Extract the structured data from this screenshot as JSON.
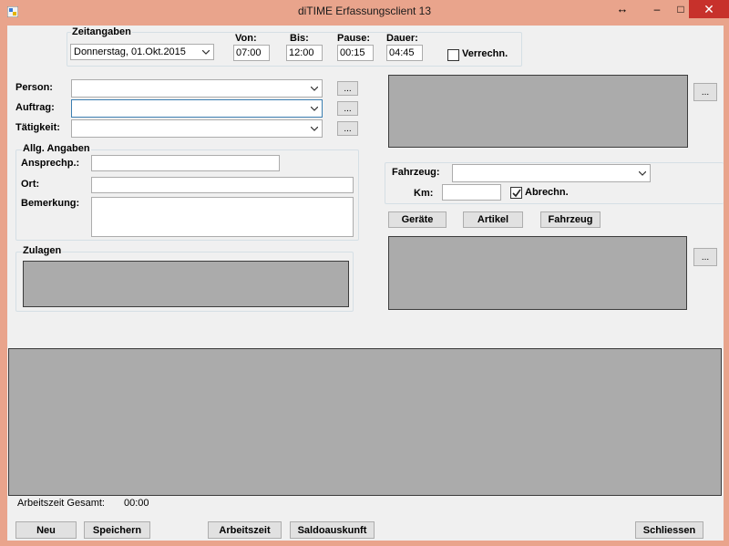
{
  "window": {
    "title": "diTIME Erfassungsclient 13",
    "controls": {
      "resize": "↔",
      "minimize": "–",
      "maximize": "□",
      "close": "✕"
    }
  },
  "zeitangaben": {
    "group_title": "Zeitangaben",
    "date_value": "Donnerstag, 01.Okt.2015",
    "von_label": "Von:",
    "von_value": "07:00",
    "bis_label": "Bis:",
    "bis_value": "12:00",
    "pause_label": "Pause:",
    "pause_value": "00:15",
    "dauer_label": "Dauer:",
    "dauer_value": "04:45",
    "verrechn_label": "Verrechn.",
    "verrechn_checked": false
  },
  "form": {
    "person_label": "Person:",
    "auftrag_label": "Auftrag:",
    "taetigkeit_label": "Tätigkeit:",
    "browse_label": "..."
  },
  "allg_angaben": {
    "group_title": "Allg. Angaben",
    "ansprechp_label": "Ansprechp.:",
    "ort_label": "Ort:",
    "bemerkung_label": "Bemerkung:"
  },
  "zulagen": {
    "group_title": "Zulagen"
  },
  "fahrzeug": {
    "fahrzeug_label": "Fahrzeug:",
    "km_label": "Km:",
    "abrechn_label": "Abrechn.",
    "abrechn_checked": true
  },
  "tabs": {
    "geraete": "Geräte",
    "artikel": "Artikel",
    "fahrzeug": "Fahrzeug"
  },
  "summary": {
    "arbeitszeit_label": "Arbeitszeit Gesamt:",
    "arbeitszeit_value": "00:00"
  },
  "footer": {
    "neu": "Neu",
    "speichern": "Speichern",
    "arbeitszeit": "Arbeitszeit",
    "saldoauskunft": "Saldoauskunft",
    "schliessen": "Schliessen"
  },
  "colors": {
    "titlebar": "#e9a48c",
    "close_button": "#c7312b",
    "panel_gray": "#ababab",
    "form_background": "#f0f0f0"
  }
}
